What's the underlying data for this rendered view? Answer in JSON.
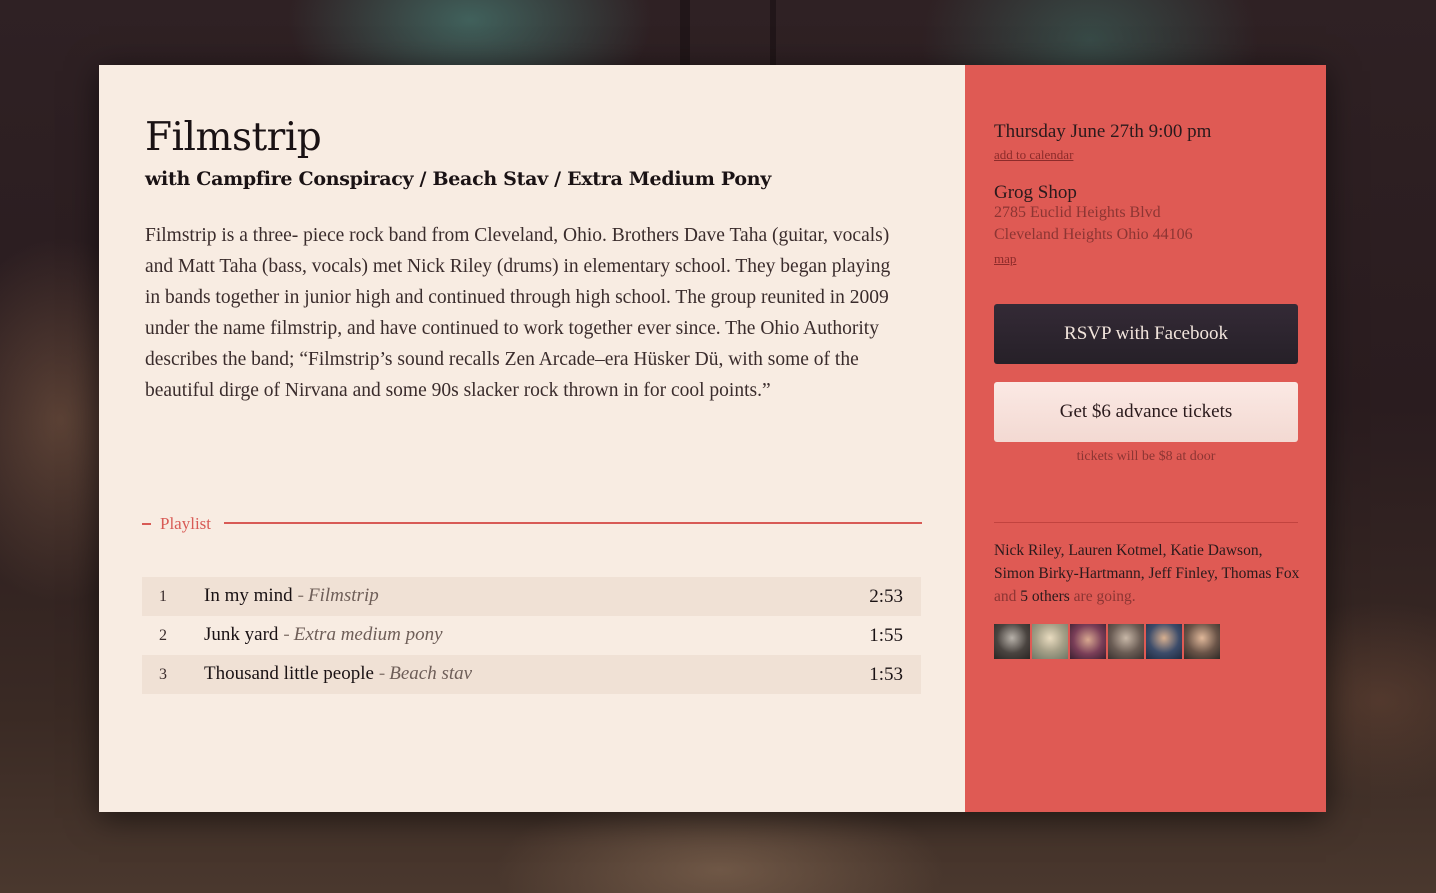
{
  "event": {
    "title": "Filmstrip",
    "support": "with Campfire Conspiracy / Beach Stav / Extra Medium Pony",
    "bio": "Filmstrip is a three- piece rock band from Cleveland, Ohio. Brothers Dave Taha (guitar, vocals) and Matt Taha (bass, vocals) met Nick Riley (drums) in elementary school. They began playing in bands together in junior high and continued through high school. The group reunited in 2009 under the name filmstrip, and have continued to work together ever since. The Ohio Authority describes the band; “Filmstrip’s sound recalls Zen Arcade–era Hüsker Dü, with some of the beautiful dirge of Nirvana and some 90s slacker rock thrown in for cool points.”"
  },
  "playlist": {
    "label": "Playlist",
    "separator": "-",
    "tracks": [
      {
        "num": "1",
        "title": "In my mind",
        "artist": "Filmstrip",
        "time": "2:53"
      },
      {
        "num": "2",
        "title": "Junk yard",
        "artist": "Extra medium pony",
        "time": "1:55"
      },
      {
        "num": "3",
        "title": "Thousand little people",
        "artist": "Beach stav",
        "time": "1:53"
      }
    ]
  },
  "details": {
    "datetime": "Thursday June 27th 9:00 pm",
    "add_to_calendar": "add to calendar",
    "venue_name": "Grog Shop",
    "address_line1": "2785 Euclid Heights Blvd",
    "address_line2": "Cleveland Heights Ohio 44106",
    "map_link": "map",
    "rsvp_label": "RSVP with Facebook",
    "tickets_label": "Get $6 advance tickets",
    "door_note": "tickets will be $8 at door"
  },
  "attendees": {
    "names": "Nick Riley, Lauren Kotmel, Katie Dawson, Simon Birky-Hartmann, Jeff Finley, Thomas Fox",
    "and_text": "and",
    "others": "5 others",
    "going_text": "are going."
  },
  "colors": {
    "panel_bg": "#f8ece2",
    "sidebar_bg": "#df5a54",
    "accent": "#d85a55",
    "rsvp_button": "#2e2630",
    "ticket_button": "#f8e3de"
  }
}
